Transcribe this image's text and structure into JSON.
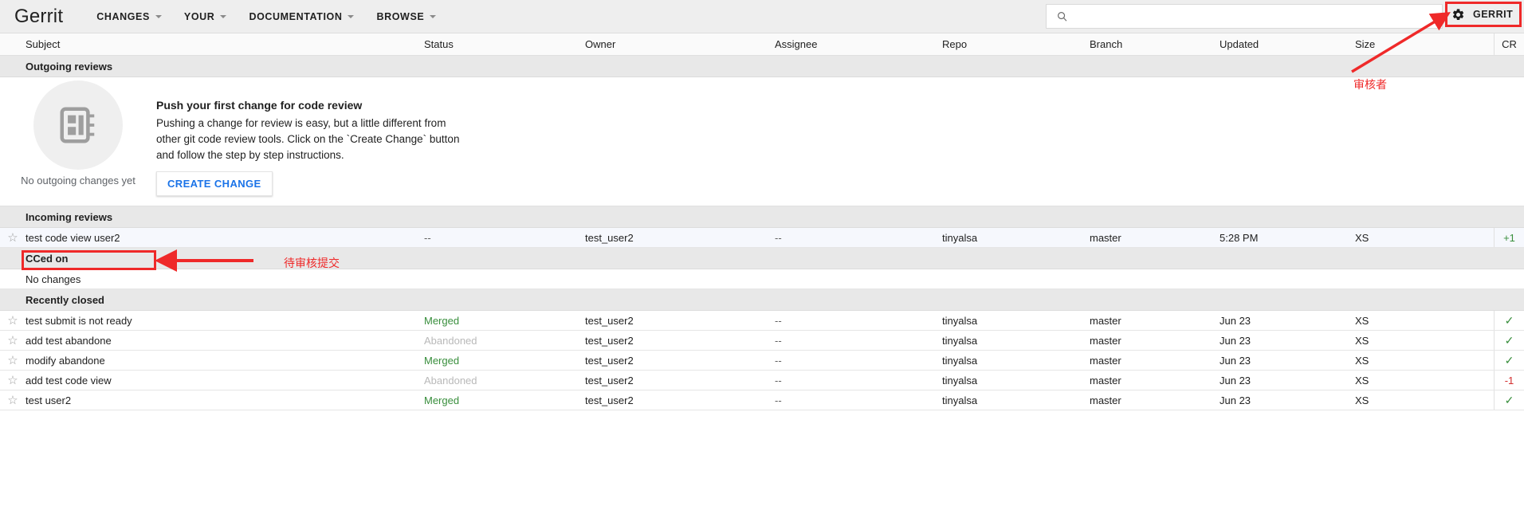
{
  "header": {
    "brand": "Gerrit",
    "nav": [
      {
        "label": "CHANGES",
        "icon": "chevron-down-icon"
      },
      {
        "label": "YOUR",
        "icon": "chevron-down-icon"
      },
      {
        "label": "DOCUMENTATION",
        "icon": "chevron-down-icon"
      },
      {
        "label": "BROWSE",
        "icon": "chevron-down-icon"
      }
    ],
    "search": {
      "value": "",
      "placeholder": "",
      "icon": "search-icon"
    },
    "account": {
      "label": "GERRIT",
      "icon": "gear-icon"
    }
  },
  "columns": {
    "subject": "Subject",
    "status": "Status",
    "owner": "Owner",
    "assignee": "Assignee",
    "repo": "Repo",
    "branch": "Branch",
    "updated": "Updated",
    "size": "Size",
    "cr": "CR"
  },
  "sections": {
    "outgoing": {
      "title": "Outgoing reviews",
      "empty": {
        "caption": "No outgoing changes yet",
        "title": "Push your first change for code review",
        "body": "Pushing a change for review is easy, but a little different from other git code review tools. Click on the `Create Change` button and follow the step by step instructions.",
        "button": "CREATE CHANGE",
        "icon": "notebook-icon"
      }
    },
    "incoming": {
      "title": "Incoming reviews",
      "rows": [
        {
          "star": "☆",
          "subject": "test code view user2",
          "status": "--",
          "status_kind": "dash",
          "owner": "test_user2",
          "assignee": "--",
          "repo": "tinyalsa",
          "branch": "master",
          "updated": "5:28 PM",
          "size": "XS",
          "cr": "+1",
          "cr_kind": "plus",
          "highlighted": true
        }
      ]
    },
    "cced": {
      "title": "CCed on",
      "empty_label": "No changes"
    },
    "closed": {
      "title": "Recently closed",
      "rows": [
        {
          "star": "☆",
          "subject": "test submit is not ready",
          "status": "Merged",
          "status_kind": "merged",
          "owner": "test_user2",
          "assignee": "--",
          "repo": "tinyalsa",
          "branch": "master",
          "updated": "Jun 23",
          "size": "XS",
          "cr": "✓",
          "cr_kind": "check"
        },
        {
          "star": "☆",
          "subject": "add test abandone",
          "status": "Abandoned",
          "status_kind": "abandoned",
          "owner": "test_user2",
          "assignee": "--",
          "repo": "tinyalsa",
          "branch": "master",
          "updated": "Jun 23",
          "size": "XS",
          "cr": "✓",
          "cr_kind": "check"
        },
        {
          "star": "☆",
          "subject": "modify abandone",
          "status": "Merged",
          "status_kind": "merged",
          "owner": "test_user2",
          "assignee": "--",
          "repo": "tinyalsa",
          "branch": "master",
          "updated": "Jun 23",
          "size": "XS",
          "cr": "✓",
          "cr_kind": "check"
        },
        {
          "star": "☆",
          "subject": "add test code view",
          "status": "Abandoned",
          "status_kind": "abandoned",
          "owner": "test_user2",
          "assignee": "--",
          "repo": "tinyalsa",
          "branch": "master",
          "updated": "Jun 23",
          "size": "XS",
          "cr": "-1",
          "cr_kind": "minus"
        },
        {
          "star": "☆",
          "subject": "test user2",
          "status": "Merged",
          "status_kind": "merged",
          "owner": "test_user2",
          "assignee": "--",
          "repo": "tinyalsa",
          "branch": "master",
          "updated": "Jun 23",
          "size": "XS",
          "cr": "✓",
          "cr_kind": "check"
        }
      ]
    }
  },
  "annotations": {
    "color": "#ef2929",
    "reviewer_label": "审核者",
    "pending_label": "待审核提交"
  }
}
